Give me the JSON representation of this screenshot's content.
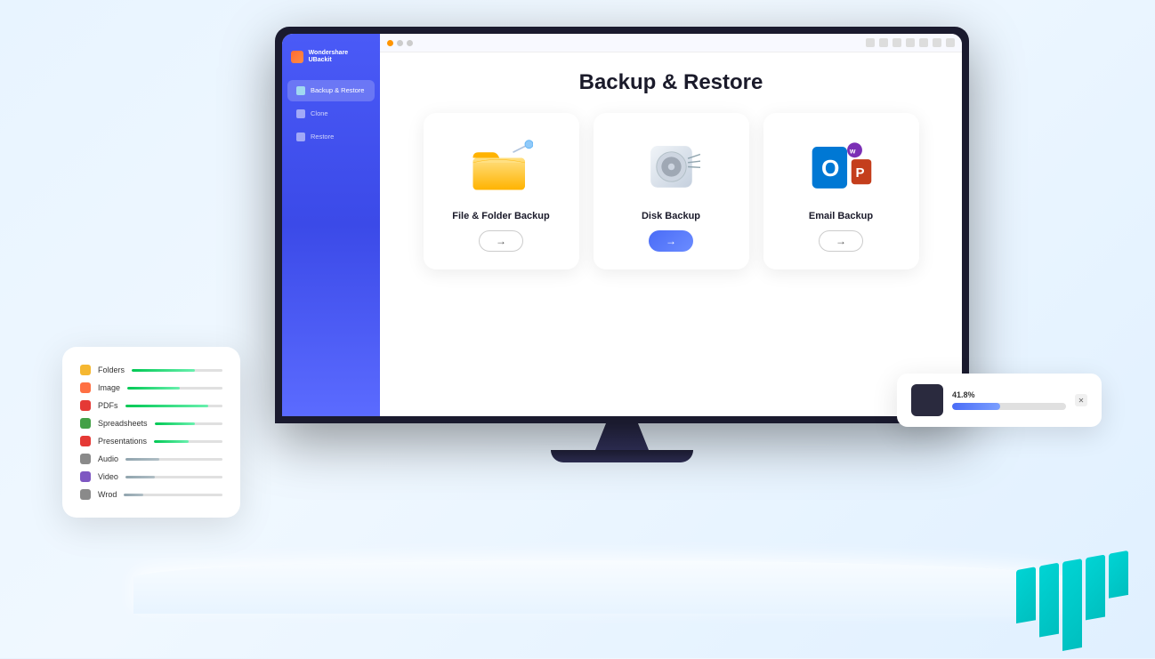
{
  "app": {
    "name": "Wondershare UBackit",
    "logo_color": "#ff6b35"
  },
  "sidebar": {
    "items": [
      {
        "label": "Backup & Restore",
        "active": true,
        "icon": "backup"
      },
      {
        "label": "Clone",
        "active": false,
        "icon": "clone"
      },
      {
        "label": "Restore",
        "active": false,
        "icon": "restore"
      }
    ]
  },
  "main": {
    "title": "Backup & Restore",
    "cards": [
      {
        "id": "file-folder",
        "title": "File & Folder Backup",
        "arrow_label": "→",
        "active": false
      },
      {
        "id": "disk",
        "title": "Disk Backup",
        "arrow_label": "→",
        "active": true
      },
      {
        "id": "email",
        "title": "Email Backup",
        "arrow_label": "→",
        "active": false
      }
    ]
  },
  "file_panel": {
    "items": [
      {
        "label": "Folders",
        "color": "#f5b731",
        "bar_pct": 70
      },
      {
        "label": "Image",
        "color": "#ff7043",
        "bar_pct": 55
      },
      {
        "label": "PDFs",
        "color": "#e53935",
        "bar_pct": 85
      },
      {
        "label": "Spreadsheets",
        "color": "#43a047",
        "bar_pct": 60
      },
      {
        "label": "Presentations",
        "color": "#e53935",
        "bar_pct": 50
      },
      {
        "label": "Audio",
        "color": "#8a8a8a",
        "bar_pct": 35
      },
      {
        "label": "Video",
        "color": "#7e57c2",
        "bar_pct": 30
      },
      {
        "label": "Wrod",
        "color": "#8a8a8a",
        "bar_pct": 20
      }
    ]
  },
  "progress_panel": {
    "percent": "41.8%",
    "bar_pct": 42,
    "close_label": "✕"
  },
  "teal_blocks": [
    {
      "height": 60
    },
    {
      "height": 80
    },
    {
      "height": 100
    },
    {
      "height": 70
    },
    {
      "height": 50
    }
  ]
}
